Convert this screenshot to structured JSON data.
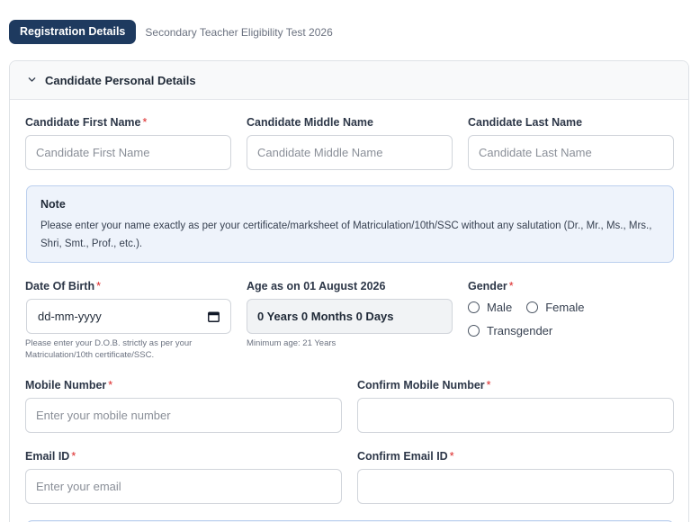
{
  "header": {
    "badge": "Registration Details",
    "subtitle": "Secondary Teacher Eligibility Test 2026"
  },
  "section": {
    "title": "Candidate Personal Details",
    "icon": "chevron-down-icon"
  },
  "fields": {
    "first_name": {
      "label": "Candidate First Name",
      "required": "*",
      "placeholder": "Candidate First Name"
    },
    "middle_name": {
      "label": "Candidate Middle Name",
      "placeholder": "Candidate Middle Name"
    },
    "last_name": {
      "label": "Candidate Last Name",
      "placeholder": "Candidate Last Name"
    },
    "dob": {
      "label": "Date Of Birth",
      "required": "*",
      "value": "dd-mm-yyyy",
      "help": "Please enter your D.O.B. strictly as per your Matriculation/10th certificate/SSC.",
      "icon": "calendar-icon"
    },
    "age": {
      "label": "Age as on 01 August 2026",
      "value": "0 Years 0 Months 0 Days",
      "help": "Minimum age: 21 Years"
    },
    "gender": {
      "label": "Gender",
      "required": "*",
      "options": [
        "Male",
        "Female",
        "Transgender"
      ]
    },
    "mobile": {
      "label": "Mobile Number",
      "required": "*",
      "placeholder": "Enter your mobile number"
    },
    "confirm_mobile": {
      "label": "Confirm Mobile Number",
      "required": "*",
      "placeholder": ""
    },
    "email": {
      "label": "Email ID",
      "required": "*",
      "placeholder": "Enter your email"
    },
    "confirm_email": {
      "label": "Confirm Email ID",
      "required": "*",
      "placeholder": ""
    }
  },
  "note": {
    "title": "Note",
    "body": "Please enter your name exactly as per your certificate/marksheet of Matriculation/10th/SSC without any salutation (Dr., Mr., Ms., Mrs., Shri, Smt., Prof., etc.)."
  },
  "colors": {
    "badge_bg": "#1e3a5f",
    "required": "#dc2626",
    "note_bg": "#eef3fb",
    "note_border": "#bcd0ee"
  }
}
